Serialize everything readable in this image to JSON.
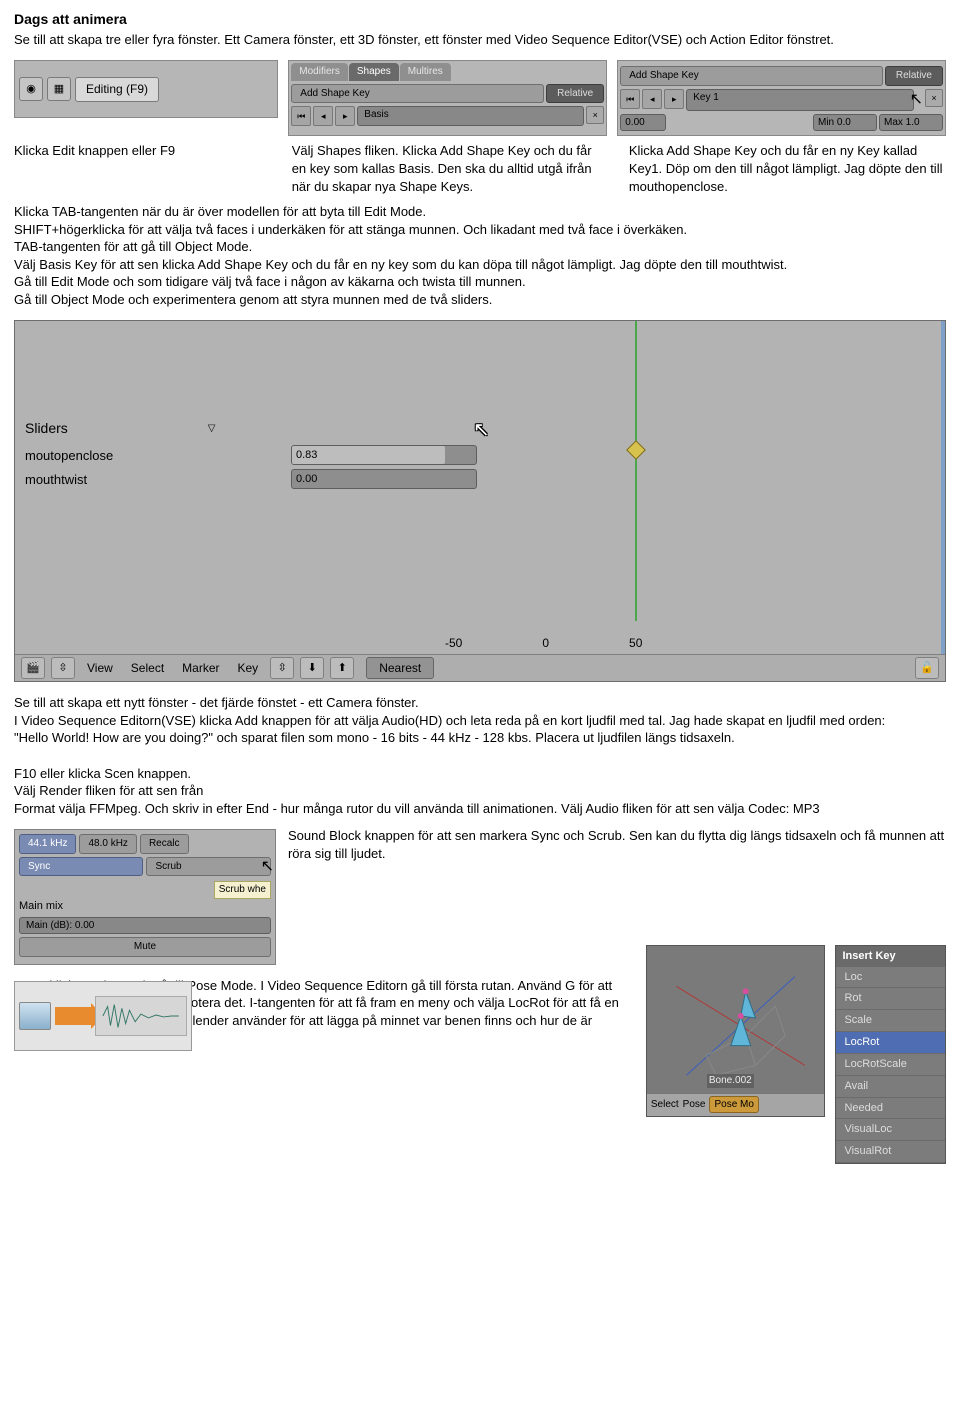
{
  "heading": "Dags att animera",
  "intro": "Se till att skapa tre eller fyra fönster. Ett Camera fönster, ett 3D fönster, ett fönster med Video Sequence Editor(VSE) och Action Editor fönstret.",
  "panel1": {
    "editing": "Editing (F9)",
    "caption": "Klicka Edit knappen eller F9"
  },
  "panel2": {
    "tabs": [
      "Modifiers",
      "Shapes",
      "Multires"
    ],
    "addshape": "Add Shape Key",
    "relative": "Relative",
    "basis": "Basis",
    "caption": "Välj Shapes fliken. Klicka Add Shape Key och du får en key som kallas Basis. Den ska du alltid utgå ifrån när du skapar nya Shape Keys."
  },
  "panel3": {
    "addshape": "Add Shape Key",
    "relative": "Relative",
    "key1": "Key 1",
    "val": "0.00",
    "min": "Min 0.0",
    "max": "Max 1.0",
    "caption": "Klicka Add Shape Key och du får en ny Key kallad Key1. Döp om den till något lämpligt. Jag döpte den till  mouthopenclose."
  },
  "midtext": "Klicka TAB-tangenten när du är över modellen för att byta till Edit Mode.\nSHIFT+högerklicka för att välja två faces i underkäken för att stänga munnen. Och likadant med två face i överkäken.\nTAB-tangenten för att gå till Object Mode.\nVälj Basis Key för att sen klicka Add Shape Key och du får en ny key som du kan döpa till något lämpligt. Jag döpte den till mouthtwist.\nGå till Edit Mode och som tidigare välj två face i  någon av käkarna och twista till munnen.\nGå till Object Mode och experimentera genom att styra munnen med de två sliders.",
  "action": {
    "sliders_label": "Sliders",
    "rows": [
      {
        "name": "moutopenclose",
        "val": "0.83",
        "fill": 83
      },
      {
        "name": "mouthtwist",
        "val": "0.00",
        "fill": 0
      }
    ],
    "axis": [
      "-50",
      "0",
      "50"
    ],
    "menu": [
      "View",
      "Select",
      "Marker",
      "Key"
    ],
    "nearest": "Nearest"
  },
  "aftertext": "Se till att skapa ett nytt fönster - det fjärde fönstet - ett Camera fönster.\nI Video Sequence Editorn(VSE) klicka Add knappen för att välja Audio(HD) och leta reda på en kort ljudfil med tal. Jag hade skapat en ljudfil med orden:\n\"Hello World! How are you doing?\" och sparat filen som mono - 16 bits - 44 kHz - 128 kbs. Placera ut ljudfilen längs tidsaxeln.\n\nF10 eller klicka Scen knappen.\nVälj Render fliken för att sen från\nFormat välja FFMpeg. Och skriv in efter End - hur många rutor du vill använda till animationen. Välj Audio fliken för att sen välja Codec: MP3",
  "sound": {
    "btns": [
      "44.1 kHz",
      "48.0 kHz",
      "Recalc"
    ],
    "sync": "Sync",
    "scrub": "Scrub",
    "tooltip": "Scrub whe",
    "mainmix": "Main mix",
    "maindb": "Main (dB): 0.00",
    "mute": "Mute",
    "caption": "Sound Block knappen för att sen markera Sync och Scrub. Sen kan du flytta dig längs tidsaxeln och få munnen att röra sig till ljudet."
  },
  "bottomtext": "Högerklicka ett ben och gå till Pose Mode. I Video Sequence Editorn gå till första rutan. Använd G för att flytta ett valt ben och R för att rotera det. I-tangenten för att få fram en meny och välja LocRot för att få en nyckelbildsruta - en ruta som Blender använder för att lägga på minnet var benen finns och hur de är roterade.",
  "view3d": {
    "bone": "Bone.002",
    "select": "Select",
    "pose": "Pose",
    "posemode": "Pose Mo"
  },
  "insertkey": {
    "title": "Insert Key",
    "items": [
      "Loc",
      "Rot",
      "Scale",
      "LocRot",
      "LocRotScale",
      "Avail",
      "Needed",
      "VisualLoc",
      "VisualRot"
    ]
  }
}
